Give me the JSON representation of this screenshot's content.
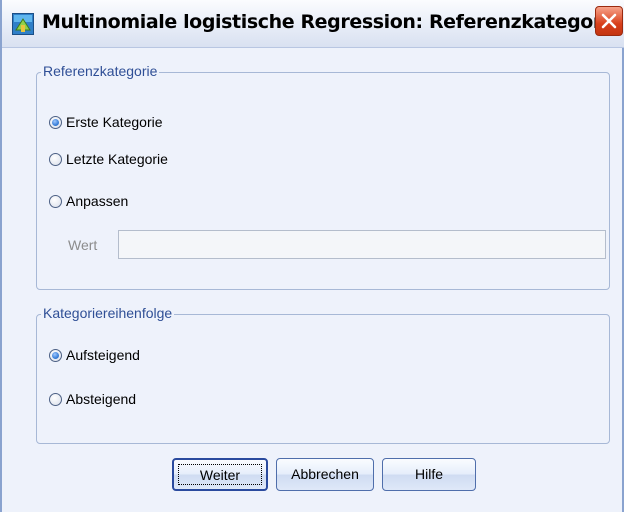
{
  "window": {
    "title": "Multinomiale logistische Regression: Referenzkategorie",
    "icons": {
      "app": "spss-dialog-icon",
      "close": "close-icon"
    }
  },
  "reference_category": {
    "legend": "Referenzkategorie",
    "options": [
      {
        "label": "Erste Kategorie",
        "checked": true
      },
      {
        "label": "Letzte Kategorie",
        "checked": false
      },
      {
        "label": "Anpassen",
        "checked": false
      }
    ],
    "value_label": "Wert",
    "value": "",
    "value_enabled": false
  },
  "category_order": {
    "legend": "Kategoriereihenfolge",
    "options": [
      {
        "label": "Aufsteigend",
        "checked": true
      },
      {
        "label": "Absteigend",
        "checked": false
      }
    ]
  },
  "buttons": {
    "continue": "Weiter",
    "cancel": "Abbrechen",
    "help": "Hilfe"
  },
  "colors": {
    "dialog_background": "#eef2fb",
    "group_legend": "#2f4f96",
    "close_button": "#d8401c"
  }
}
